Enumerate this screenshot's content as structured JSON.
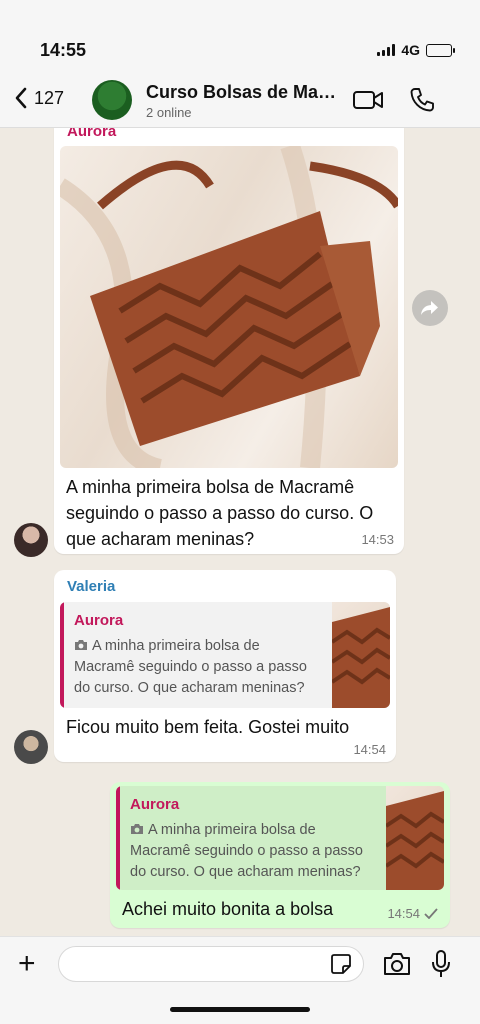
{
  "status_bar": {
    "time": "14:55",
    "network": "4G"
  },
  "header": {
    "back_count": "127",
    "title": "Curso Bolsas de Macramê",
    "subtitle": "2 online"
  },
  "messages": [
    {
      "sender": "Aurora",
      "text": "A minha primeira bolsa de Macramê seguindo o passo a passo do curso. O que acharam meninas?",
      "time": "14:53"
    },
    {
      "sender": "Valeria",
      "quote_name": "Aurora",
      "quote_text": "A minha primeira bolsa de Macramê seguindo o passo a passo do curso. O que acharam meninas?",
      "text": "Ficou muito bem feita. Gostei muito",
      "time": "14:54"
    },
    {
      "quote_name": "Aurora",
      "quote_text": "A minha primeira bolsa de Macramê seguindo o passo a passo do curso. O que acharam meninas?",
      "text": "Achei muito bonita a bolsa",
      "time": "14:54"
    }
  ],
  "input": {
    "placeholder": ""
  },
  "colors": {
    "accent_aurora": "#c2185b",
    "accent_valeria": "#2f7fb5",
    "outgoing_bubble": "#d9fdd3",
    "chat_background": "#efeae2"
  }
}
